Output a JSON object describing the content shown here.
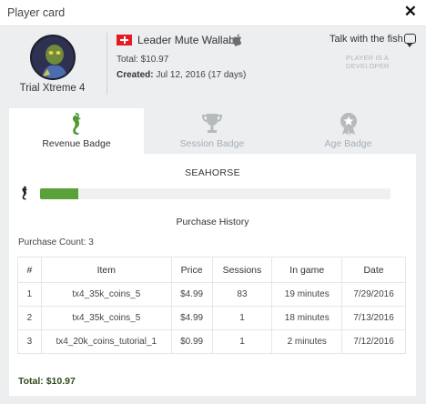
{
  "window": {
    "title": "Player card",
    "close_icon": "close-icon"
  },
  "player": {
    "avatar_label": "Trial Xtreme 4",
    "name": "Leader Mute Wallaby",
    "flag": "switzerland-flag",
    "platform_icon": "apple-icon",
    "total": "Total: $10.97",
    "created_label": "Created:",
    "created_value": "Jul 12, 2016 (17 days)",
    "talk_label": "Talk with the fish",
    "developer_note": "PLAYER IS A DEVELOPER"
  },
  "tabs": [
    {
      "label": "Revenue Badge",
      "icon": "seahorse-icon",
      "active": true
    },
    {
      "label": "Session Badge",
      "icon": "trophy-icon",
      "active": false
    },
    {
      "label": "Age Badge",
      "icon": "medal-icon",
      "active": false
    }
  ],
  "badge": {
    "name": "SEAHORSE",
    "progress_fraction": 0.11
  },
  "purchase_history": {
    "title": "Purchase History",
    "count_label": "Purchase Count: 3",
    "columns": [
      "#",
      "Item",
      "Price",
      "Sessions",
      "In game",
      "Date"
    ],
    "rows": [
      [
        "1",
        "tx4_35k_coins_5",
        "$4.99",
        "83",
        "19 minutes",
        "7/29/2016"
      ],
      [
        "2",
        "tx4_35k_coins_5",
        "$4.99",
        "1",
        "18 minutes",
        "7/13/2016"
      ],
      [
        "3",
        "tx4_20k_coins_tutorial_1",
        "$0.99",
        "1",
        "2 minutes",
        "7/12/2016"
      ]
    ],
    "total_label": "Total: $10.97"
  },
  "colors": {
    "accent_green": "#5aa13a",
    "panel_bg": "#eceef0",
    "flag_red": "#e31b23"
  }
}
